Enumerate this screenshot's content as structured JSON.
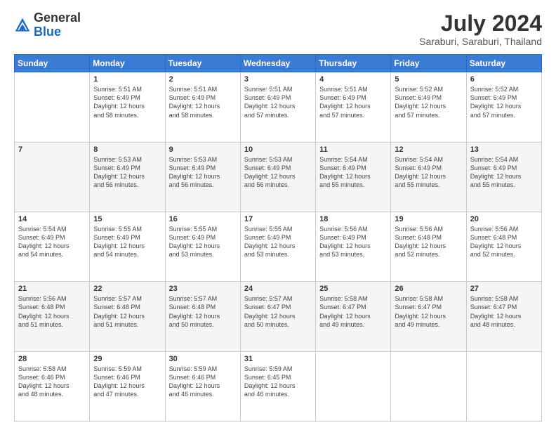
{
  "header": {
    "logo_general": "General",
    "logo_blue": "Blue",
    "title": "July 2024",
    "subtitle": "Saraburi, Saraburi, Thailand"
  },
  "calendar": {
    "days_of_week": [
      "Sunday",
      "Monday",
      "Tuesday",
      "Wednesday",
      "Thursday",
      "Friday",
      "Saturday"
    ],
    "weeks": [
      [
        {
          "day": "",
          "info": ""
        },
        {
          "day": "1",
          "info": "Sunrise: 5:51 AM\nSunset: 6:49 PM\nDaylight: 12 hours\nand 58 minutes."
        },
        {
          "day": "2",
          "info": "Sunrise: 5:51 AM\nSunset: 6:49 PM\nDaylight: 12 hours\nand 58 minutes."
        },
        {
          "day": "3",
          "info": "Sunrise: 5:51 AM\nSunset: 6:49 PM\nDaylight: 12 hours\nand 57 minutes."
        },
        {
          "day": "4",
          "info": "Sunrise: 5:51 AM\nSunset: 6:49 PM\nDaylight: 12 hours\nand 57 minutes."
        },
        {
          "day": "5",
          "info": "Sunrise: 5:52 AM\nSunset: 6:49 PM\nDaylight: 12 hours\nand 57 minutes."
        },
        {
          "day": "6",
          "info": "Sunrise: 5:52 AM\nSunset: 6:49 PM\nDaylight: 12 hours\nand 57 minutes."
        }
      ],
      [
        {
          "day": "7",
          "info": ""
        },
        {
          "day": "8",
          "info": "Sunrise: 5:53 AM\nSunset: 6:49 PM\nDaylight: 12 hours\nand 56 minutes."
        },
        {
          "day": "9",
          "info": "Sunrise: 5:53 AM\nSunset: 6:49 PM\nDaylight: 12 hours\nand 56 minutes."
        },
        {
          "day": "10",
          "info": "Sunrise: 5:53 AM\nSunset: 6:49 PM\nDaylight: 12 hours\nand 56 minutes."
        },
        {
          "day": "11",
          "info": "Sunrise: 5:54 AM\nSunset: 6:49 PM\nDaylight: 12 hours\nand 55 minutes."
        },
        {
          "day": "12",
          "info": "Sunrise: 5:54 AM\nSunset: 6:49 PM\nDaylight: 12 hours\nand 55 minutes."
        },
        {
          "day": "13",
          "info": "Sunrise: 5:54 AM\nSunset: 6:49 PM\nDaylight: 12 hours\nand 55 minutes."
        }
      ],
      [
        {
          "day": "14",
          "info": "Sunrise: 5:54 AM\nSunset: 6:49 PM\nDaylight: 12 hours\nand 54 minutes."
        },
        {
          "day": "15",
          "info": "Sunrise: 5:55 AM\nSunset: 6:49 PM\nDaylight: 12 hours\nand 54 minutes."
        },
        {
          "day": "16",
          "info": "Sunrise: 5:55 AM\nSunset: 6:49 PM\nDaylight: 12 hours\nand 53 minutes."
        },
        {
          "day": "17",
          "info": "Sunrise: 5:55 AM\nSunset: 6:49 PM\nDaylight: 12 hours\nand 53 minutes."
        },
        {
          "day": "18",
          "info": "Sunrise: 5:56 AM\nSunset: 6:49 PM\nDaylight: 12 hours\nand 53 minutes."
        },
        {
          "day": "19",
          "info": "Sunrise: 5:56 AM\nSunset: 6:48 PM\nDaylight: 12 hours\nand 52 minutes."
        },
        {
          "day": "20",
          "info": "Sunrise: 5:56 AM\nSunset: 6:48 PM\nDaylight: 12 hours\nand 52 minutes."
        }
      ],
      [
        {
          "day": "21",
          "info": "Sunrise: 5:56 AM\nSunset: 6:48 PM\nDaylight: 12 hours\nand 51 minutes."
        },
        {
          "day": "22",
          "info": "Sunrise: 5:57 AM\nSunset: 6:48 PM\nDaylight: 12 hours\nand 51 minutes."
        },
        {
          "day": "23",
          "info": "Sunrise: 5:57 AM\nSunset: 6:48 PM\nDaylight: 12 hours\nand 50 minutes."
        },
        {
          "day": "24",
          "info": "Sunrise: 5:57 AM\nSunset: 6:47 PM\nDaylight: 12 hours\nand 50 minutes."
        },
        {
          "day": "25",
          "info": "Sunrise: 5:58 AM\nSunset: 6:47 PM\nDaylight: 12 hours\nand 49 minutes."
        },
        {
          "day": "26",
          "info": "Sunrise: 5:58 AM\nSunset: 6:47 PM\nDaylight: 12 hours\nand 49 minutes."
        },
        {
          "day": "27",
          "info": "Sunrise: 5:58 AM\nSunset: 6:47 PM\nDaylight: 12 hours\nand 48 minutes."
        }
      ],
      [
        {
          "day": "28",
          "info": "Sunrise: 5:58 AM\nSunset: 6:46 PM\nDaylight: 12 hours\nand 48 minutes."
        },
        {
          "day": "29",
          "info": "Sunrise: 5:59 AM\nSunset: 6:46 PM\nDaylight: 12 hours\nand 47 minutes."
        },
        {
          "day": "30",
          "info": "Sunrise: 5:59 AM\nSunset: 6:46 PM\nDaylight: 12 hours\nand 46 minutes."
        },
        {
          "day": "31",
          "info": "Sunrise: 5:59 AM\nSunset: 6:45 PM\nDaylight: 12 hours\nand 46 minutes."
        },
        {
          "day": "",
          "info": ""
        },
        {
          "day": "",
          "info": ""
        },
        {
          "day": "",
          "info": ""
        }
      ]
    ]
  }
}
